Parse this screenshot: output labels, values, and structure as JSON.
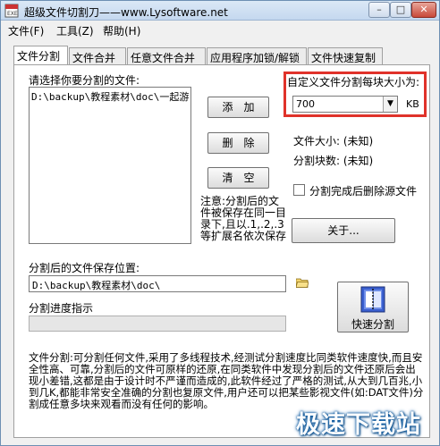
{
  "title": "超级文件切割刀——www.Lysoftware.net",
  "window_buttons": {
    "minimize": "–",
    "maximize": "□",
    "close": "✕"
  },
  "menu": [
    "文件(F)",
    "工具(Z)",
    "帮助(H)"
  ],
  "tabs": [
    "文件分割",
    "文件合并",
    "任意文件合并",
    "应用程序加锁/解锁",
    "文件快速复制"
  ],
  "split": {
    "select_label": "请选择你要分割的文件:",
    "file_list": [
      "D:\\backup\\教程素材\\doc\\一起游"
    ],
    "buttons": {
      "add": "添　加",
      "delete": "删　除",
      "clear": "清　空",
      "about": "关于..."
    },
    "note": "注意:分割后的文件被保存在同一目录下,且以.1,.2,.3等扩展名依次保存",
    "size_label": "自定义文件分割每块大小为:",
    "size_value": "700",
    "size_unit": "KB",
    "file_size": "文件大小: (未知)",
    "block_count": "分割块数: (未知)",
    "delete_after_label": "分割完成后删除源文件",
    "delete_after_checked": false,
    "save_label": "分割后的文件保存位置:",
    "save_path": "D:\\backup\\教程素材\\doc\\",
    "progress_label": "分割进度指示",
    "progress": 0,
    "quick_split": "快速分割",
    "description": "文件分割:可分割任何文件,采用了多线程技术,经测试分割速度比同类软件速度快,而且安全性高、可靠,分割后的文件可原样的还原,在同类软件中发现分割后的文件还原后会出现小差错,这都是由于设计时不严谨而造成的,此软件经过了严格的测试,从大到几百兆,小到几K,都能非常安全准确的分割也复原文件,用户还可以把某些影视文件(如:DAT文件)分割成任意多块来观看而没有任何的影响。"
  },
  "watermark": "极速下载站",
  "colors": {
    "highlight": "#e0322a",
    "watermark": "#0a5aa3"
  }
}
